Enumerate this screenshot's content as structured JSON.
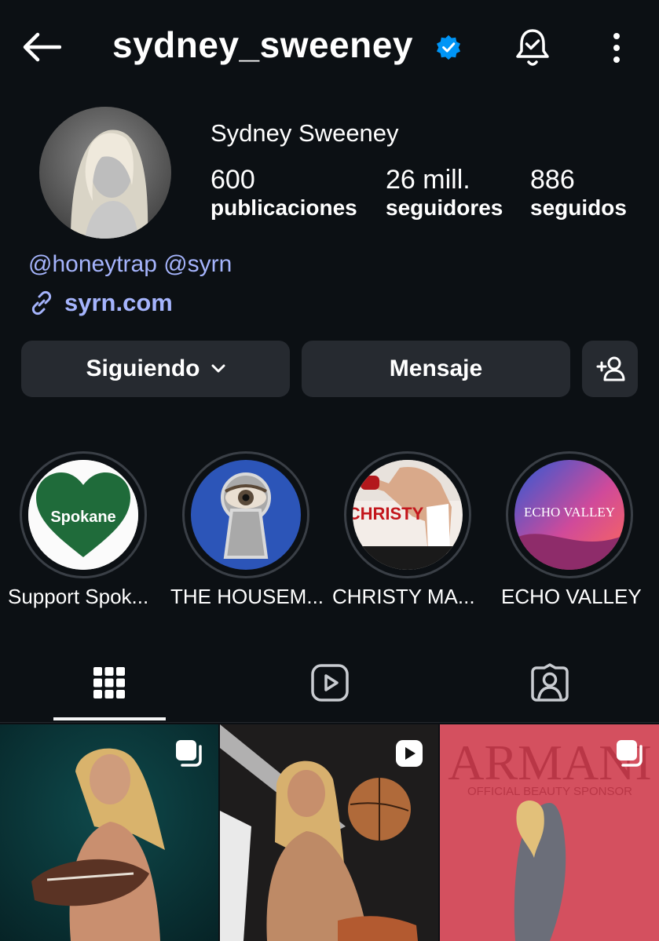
{
  "header": {
    "username": "sydney_sweeney",
    "verified_icon": "verified-badge-icon",
    "accent": "#0095f6"
  },
  "profile": {
    "full_name": "Sydney Sweeney",
    "stats": [
      {
        "value": "600",
        "label": "publicaciones"
      },
      {
        "value": "26 mill.",
        "label": "seguidores"
      },
      {
        "value": "886",
        "label": "seguidos"
      }
    ],
    "threads_links": "@honeytrap @syrn",
    "website": "syrn.com",
    "link_color": "#a5b4fc"
  },
  "actions": {
    "following_label": "Siguiendo",
    "message_label": "Mensaje",
    "add_user_icon": "add-person-icon"
  },
  "highlights": [
    {
      "label": "Support Spok...",
      "cover_text": "Spokane"
    },
    {
      "label": "THE HOUSEM..."
    },
    {
      "label": "CHRISTY MA...",
      "cover_text": "CHRISTY"
    },
    {
      "label": "ECHO VALLEY",
      "cover_text": "ECHO VALLEY"
    }
  ],
  "tabs": [
    {
      "name": "grid",
      "icon": "grid-icon",
      "active": true
    },
    {
      "name": "reels",
      "icon": "reels-icon",
      "active": false
    },
    {
      "name": "tagged",
      "icon": "tagged-icon",
      "active": false
    }
  ],
  "posts": [
    {
      "type": "carousel",
      "badge_icon": "carousel-icon"
    },
    {
      "type": "reel",
      "badge_icon": "reel-play-icon"
    },
    {
      "type": "carousel",
      "badge_icon": "carousel-icon",
      "overlay_title": "ARMANI",
      "overlay_subtitle": "OFFICIAL BEAUTY SPONSOR"
    }
  ]
}
